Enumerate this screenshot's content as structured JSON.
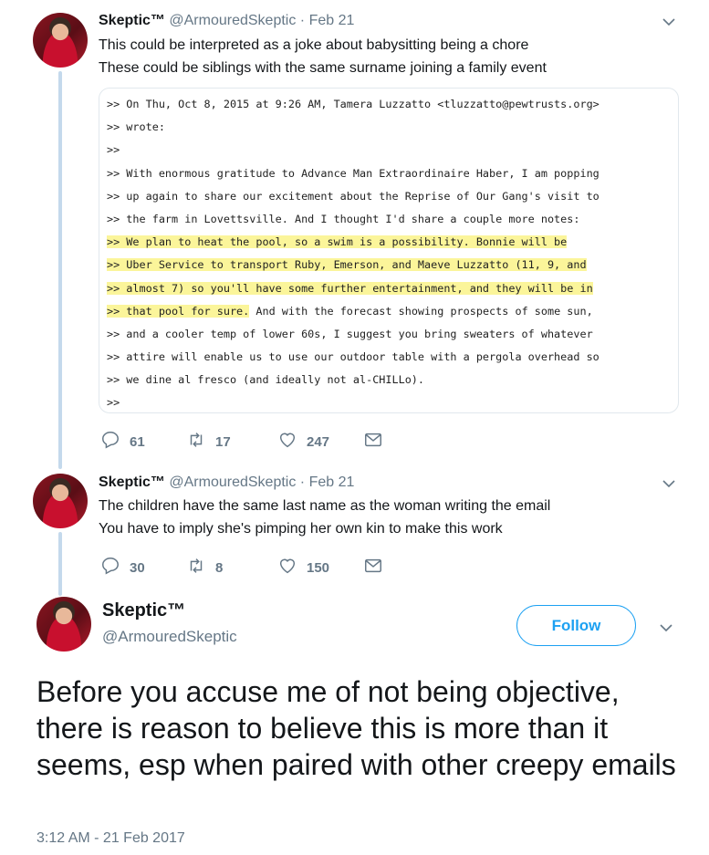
{
  "tweets": [
    {
      "name": "Skeptic™",
      "handle": "@ArmouredSkeptic",
      "date": "Feb 21",
      "lines": [
        "This could be interpreted as a joke about babysitting being a chore",
        "These could be siblings with the same surname joining a family event"
      ],
      "email_lines": [
        ">> On Thu, Oct 8, 2015 at 9:26 AM, Tamera Luzzatto <tluzzatto@pewtrusts.org>",
        ">> wrote:",
        ">>",
        ">> With enormous gratitude to Advance Man Extraordinaire Haber, I am popping",
        ">> up again to share our excitement about the Reprise of Our Gang's visit to",
        ">> the farm in Lovettsville. And I thought I'd share a couple more notes:",
        ">> We plan to heat the pool, so a swim is a possibility. Bonnie will be",
        ">> Uber Service to transport Ruby, Emerson, and Maeve Luzzatto (11, 9, and",
        ">> almost 7) so you'll have some further entertainment, and they will be in",
        ">> that pool for sure.",
        " And with the forecast showing prospects of some sun,",
        ">> and a cooler temp of lower 60s, I suggest you bring sweaters of whatever",
        ">> attire will enable us to use our outdoor table with a pergola overhead so",
        ">> we dine al fresco (and ideally not al-CHILLo).",
        ">>"
      ],
      "replies": "61",
      "retweets": "17",
      "likes": "247"
    },
    {
      "name": "Skeptic™",
      "handle": "@ArmouredSkeptic",
      "date": "Feb 21",
      "lines": [
        "The children have the same last name as the woman writing the email",
        "You have to imply she's pimping her own kin to make this work"
      ],
      "replies": "30",
      "retweets": "8",
      "likes": "150"
    }
  ],
  "main": {
    "name": "Skeptic™",
    "handle": "@ArmouredSkeptic",
    "follow_label": "Follow",
    "text": "Before you accuse me of not being objective, there is reason to believe this is more than it seems, esp when paired with other creepy emails",
    "timestamp": "3:12 AM - 21 Feb 2017"
  },
  "icons": {
    "reply": "reply-icon",
    "retweet": "retweet-icon",
    "like": "heart-icon",
    "dm": "envelope-icon",
    "menu": "chevron-down-icon"
  },
  "colors": {
    "thread_line": "#c4d9ec",
    "follow": "#1da1f2",
    "highlight": "#fbf59a"
  }
}
